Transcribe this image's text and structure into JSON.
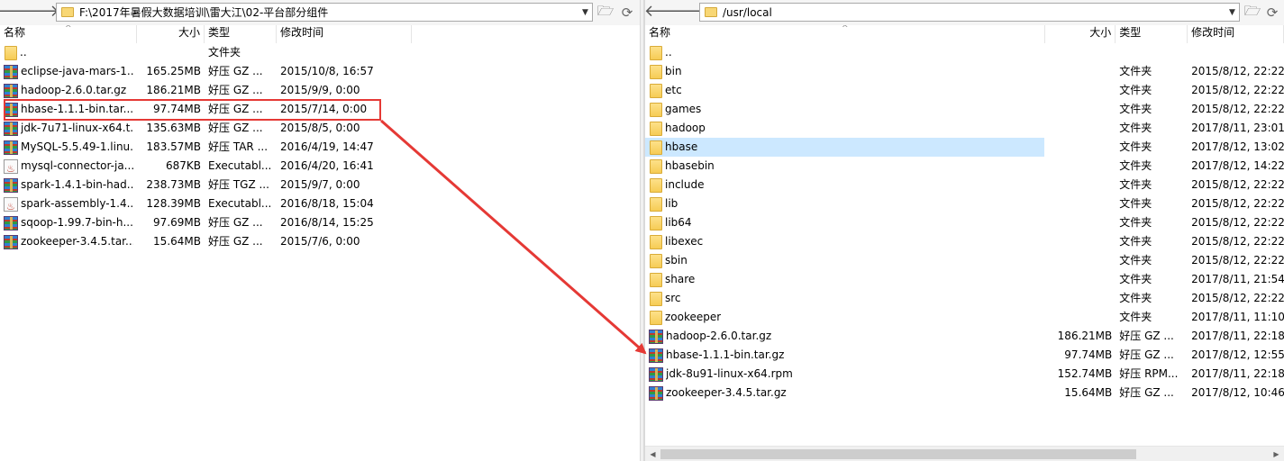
{
  "left": {
    "path": "F:\\2017年暑假大数据培训\\雷大江\\02-平台部分组件",
    "headers": {
      "name": "名称",
      "size": "大小",
      "type": "类型",
      "modified": "修改时间"
    },
    "files": [
      {
        "icon": "folder-icon",
        "name": "..",
        "size": "",
        "type": "文件夹",
        "modified": ""
      },
      {
        "icon": "archive-icon",
        "name": "eclipse-java-mars-1...",
        "size": "165.25MB",
        "type": "好压 GZ ...",
        "modified": "2015/10/8, 16:57"
      },
      {
        "icon": "archive-icon",
        "name": "hadoop-2.6.0.tar.gz",
        "size": "186.21MB",
        "type": "好压 GZ ...",
        "modified": "2015/9/9, 0:00"
      },
      {
        "icon": "archive-icon",
        "name": "hbase-1.1.1-bin.tar....",
        "size": "97.74MB",
        "type": "好压 GZ ...",
        "modified": "2015/7/14, 0:00"
      },
      {
        "icon": "archive-icon",
        "name": "jdk-7u71-linux-x64.t...",
        "size": "135.63MB",
        "type": "好压 GZ ...",
        "modified": "2015/8/5, 0:00"
      },
      {
        "icon": "archive-icon",
        "name": "MySQL-5.5.49-1.linu...",
        "size": "183.57MB",
        "type": "好压 TAR ...",
        "modified": "2016/4/19, 14:47"
      },
      {
        "icon": "jar-icon",
        "name": "mysql-connector-ja...",
        "size": "687KB",
        "type": "Executabl...",
        "modified": "2016/4/20, 16:41"
      },
      {
        "icon": "archive-icon",
        "name": "spark-1.4.1-bin-had...",
        "size": "238.73MB",
        "type": "好压 TGZ ...",
        "modified": "2015/9/7, 0:00"
      },
      {
        "icon": "jar-icon",
        "name": "spark-assembly-1.4....",
        "size": "128.39MB",
        "type": "Executabl...",
        "modified": "2016/8/18, 15:04"
      },
      {
        "icon": "archive-icon",
        "name": "sqoop-1.99.7-bin-h...",
        "size": "97.69MB",
        "type": "好压 GZ ...",
        "modified": "2016/8/14, 15:25"
      },
      {
        "icon": "archive-icon",
        "name": "zookeeper-3.4.5.tar....",
        "size": "15.64MB",
        "type": "好压 GZ ...",
        "modified": "2015/7/6, 0:00"
      }
    ]
  },
  "right": {
    "path": "/usr/local",
    "headers": {
      "name": "名称",
      "size": "大小",
      "type": "类型",
      "modified": "修改时间"
    },
    "files": [
      {
        "icon": "folder-icon",
        "name": "..",
        "size": "",
        "type": "",
        "modified": ""
      },
      {
        "icon": "folder-icon",
        "name": "bin",
        "size": "",
        "type": "文件夹",
        "modified": "2015/8/12, 22:22"
      },
      {
        "icon": "folder-icon",
        "name": "etc",
        "size": "",
        "type": "文件夹",
        "modified": "2015/8/12, 22:22"
      },
      {
        "icon": "folder-icon",
        "name": "games",
        "size": "",
        "type": "文件夹",
        "modified": "2015/8/12, 22:22"
      },
      {
        "icon": "folder-icon",
        "name": "hadoop",
        "size": "",
        "type": "文件夹",
        "modified": "2017/8/11, 23:01"
      },
      {
        "icon": "folder-icon",
        "name": "hbase",
        "size": "",
        "type": "文件夹",
        "modified": "2017/8/12, 13:02",
        "selected": true
      },
      {
        "icon": "folder-icon",
        "name": "hbasebin",
        "size": "",
        "type": "文件夹",
        "modified": "2017/8/12, 14:22"
      },
      {
        "icon": "folder-icon",
        "name": "include",
        "size": "",
        "type": "文件夹",
        "modified": "2015/8/12, 22:22"
      },
      {
        "icon": "folder-icon",
        "name": "lib",
        "size": "",
        "type": "文件夹",
        "modified": "2015/8/12, 22:22"
      },
      {
        "icon": "folder-icon",
        "name": "lib64",
        "size": "",
        "type": "文件夹",
        "modified": "2015/8/12, 22:22"
      },
      {
        "icon": "folder-icon",
        "name": "libexec",
        "size": "",
        "type": "文件夹",
        "modified": "2015/8/12, 22:22"
      },
      {
        "icon": "folder-icon",
        "name": "sbin",
        "size": "",
        "type": "文件夹",
        "modified": "2015/8/12, 22:22"
      },
      {
        "icon": "folder-icon",
        "name": "share",
        "size": "",
        "type": "文件夹",
        "modified": "2017/8/11, 21:54"
      },
      {
        "icon": "folder-icon",
        "name": "src",
        "size": "",
        "type": "文件夹",
        "modified": "2015/8/12, 22:22"
      },
      {
        "icon": "folder-icon",
        "name": "zookeeper",
        "size": "",
        "type": "文件夹",
        "modified": "2017/8/11, 11:10"
      },
      {
        "icon": "archive-icon",
        "name": "hadoop-2.6.0.tar.gz",
        "size": "186.21MB",
        "type": "好压 GZ ...",
        "modified": "2017/8/11, 22:18"
      },
      {
        "icon": "archive-icon",
        "name": "hbase-1.1.1-bin.tar.gz",
        "size": "97.74MB",
        "type": "好压 GZ ...",
        "modified": "2017/8/12, 12:55"
      },
      {
        "icon": "archive-icon",
        "name": "jdk-8u91-linux-x64.rpm",
        "size": "152.74MB",
        "type": "好压 RPM...",
        "modified": "2017/8/11, 22:18"
      },
      {
        "icon": "archive-icon",
        "name": "zookeeper-3.4.5.tar.gz",
        "size": "15.64MB",
        "type": "好压 GZ ...",
        "modified": "2017/8/12, 10:46"
      }
    ]
  },
  "icons": {
    "back": "back-arrow-icon",
    "forward": "forward-arrow-icon",
    "dropdown": "chevron-down-icon",
    "open_folder": "open-folder-icon",
    "refresh": "refresh-icon"
  },
  "annotation": {
    "color": "#e53935",
    "selection_color": "#cce8ff"
  }
}
